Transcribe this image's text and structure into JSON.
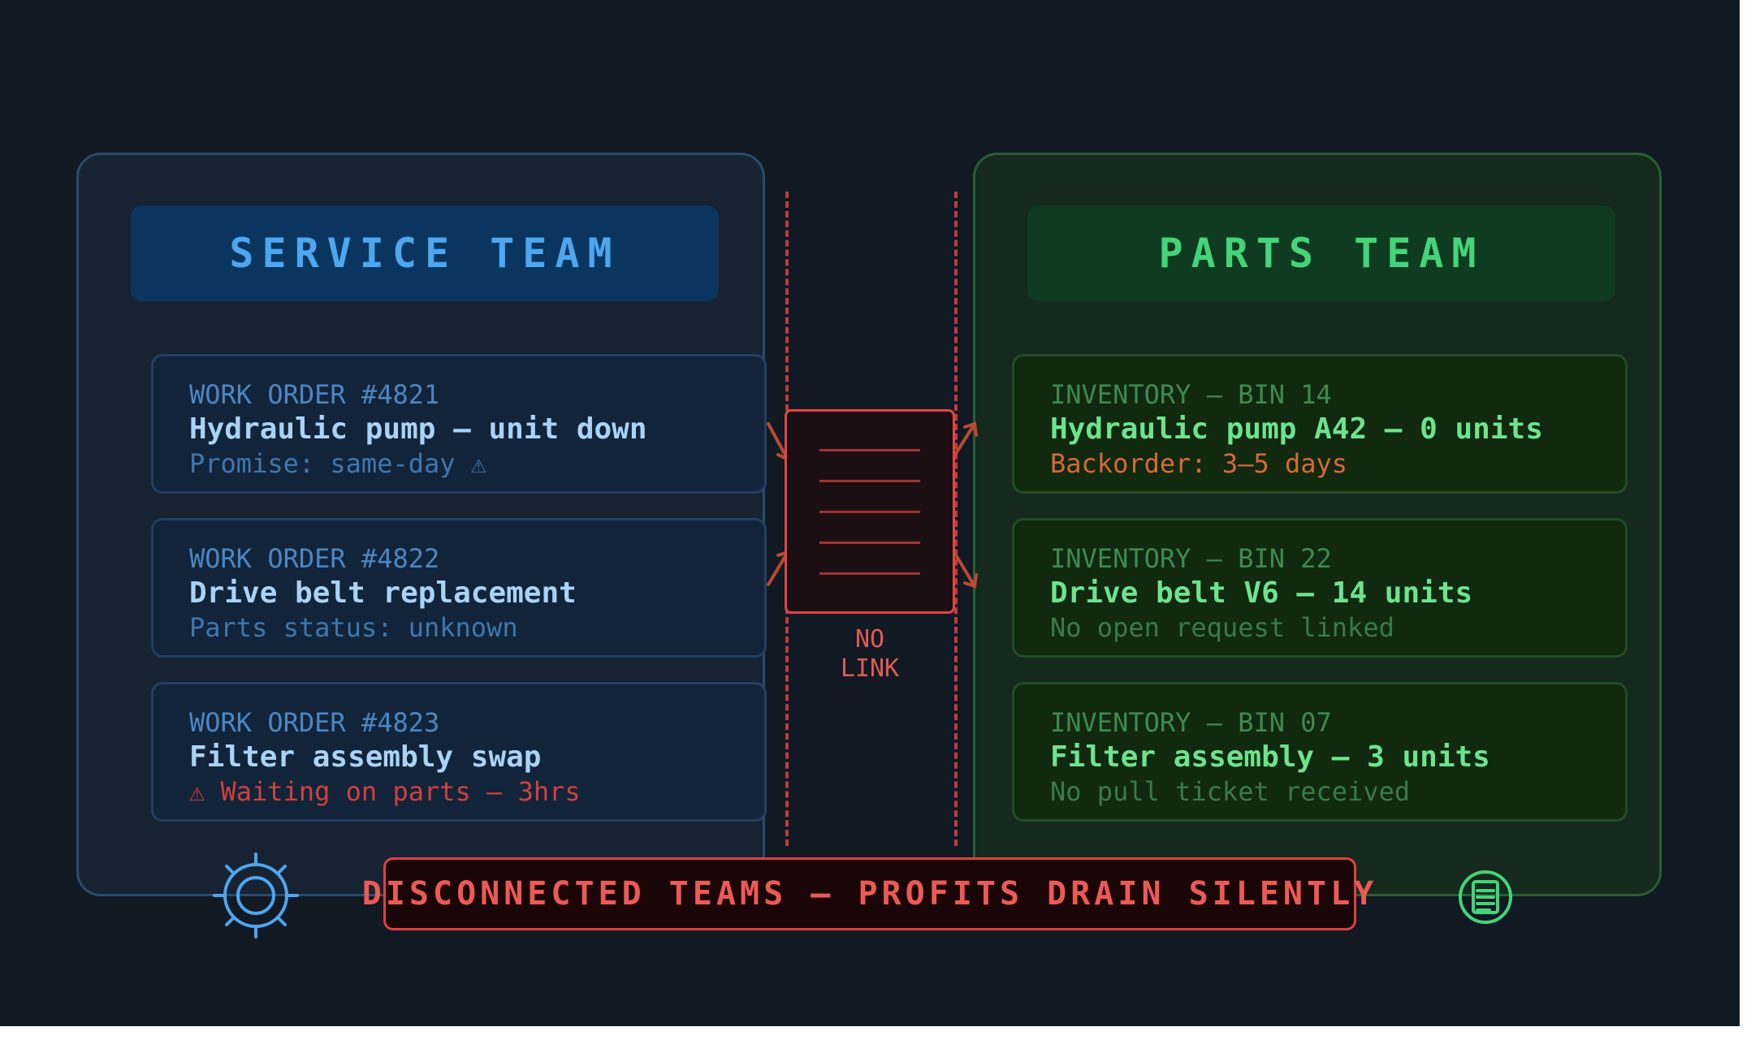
{
  "service_team": {
    "header": "SERVICE TEAM",
    "icon": "gear-icon",
    "accent_color": "#4da6f0",
    "work_orders": [
      {
        "label": "WORK ORDER #4821",
        "title": "Hydraulic pump — unit down",
        "status": "Promise: same-day ⚠"
      },
      {
        "label": "WORK ORDER #4822",
        "title": "Drive belt replacement",
        "status": "Parts status: unknown"
      },
      {
        "label": "WORK ORDER #4823",
        "title": "Filter assembly swap",
        "status": "⚠ Waiting on parts — 3hrs"
      }
    ]
  },
  "parts_team": {
    "header": "PARTS TEAM",
    "icon": "inventory-list-icon",
    "accent_color": "#44d479",
    "inventory": [
      {
        "label": "INVENTORY — BIN 14",
        "title": "Hydraulic pump A42 — 0 units",
        "status": "Backorder: 3–5 days"
      },
      {
        "label": "INVENTORY — BIN 22",
        "title": "Drive belt V6 — 14 units",
        "status": "No open request linked"
      },
      {
        "label": "INVENTORY — BIN 07",
        "title": "Filter assembly — 3 units",
        "status": "No pull ticket received"
      }
    ]
  },
  "gap": {
    "label": "NO\nLINK",
    "icon": "document-icon",
    "color": "#e04545"
  },
  "banner": {
    "text": "DISCONNECTED TEAMS — PROFITS DRAIN SILENTLY"
  }
}
